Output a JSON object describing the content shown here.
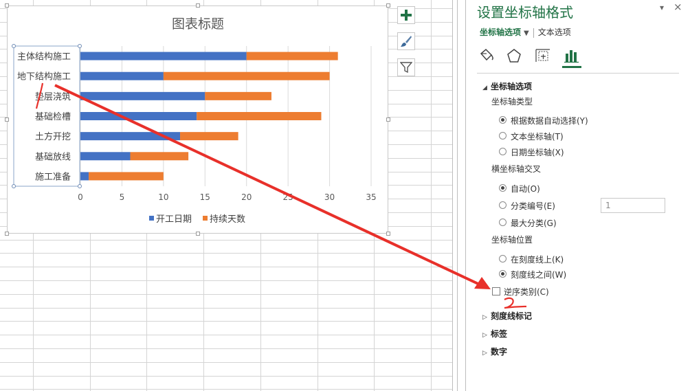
{
  "chart_data": {
    "type": "bar",
    "orientation": "horizontal",
    "stacked": true,
    "title": "图表标题",
    "categories": [
      "主体结构施工",
      "地下结构施工",
      "垫层浇筑",
      "基础检槽",
      "土方开挖",
      "基础放线",
      "施工准备"
    ],
    "series": [
      {
        "name": "开工日期",
        "color": "#4472c4",
        "values": [
          20,
          10,
          15,
          14,
          12,
          6,
          1
        ]
      },
      {
        "name": "持续天数",
        "color": "#ed7d31",
        "values": [
          11,
          20,
          8,
          15,
          7,
          7,
          9
        ]
      }
    ],
    "xlim": [
      0,
      35
    ],
    "xticks": [
      "0",
      "5",
      "10",
      "15",
      "20",
      "25",
      "30",
      "35"
    ],
    "grid": true,
    "legend_position": "bottom"
  },
  "pane": {
    "title": "设置坐标轴格式",
    "pin": "▾",
    "close": "×",
    "tab_axis_options": "坐标轴选项",
    "tab_text_options": "文本选项",
    "icons": [
      "fill-line-icon",
      "effects-icon",
      "size-properties-icon",
      "axis-options-icon"
    ],
    "section_axis_options": "坐标轴选项",
    "axis_type_label": "坐标轴类型",
    "axis_type_options": [
      {
        "label": "根据数据自动选择(Y)",
        "checked": true
      },
      {
        "label": "文本坐标轴(T)",
        "checked": false
      },
      {
        "label": "日期坐标轴(X)",
        "checked": false
      }
    ],
    "cross_label": "横坐标轴交叉",
    "cross_options": [
      {
        "label": "自动(O)",
        "checked": true
      },
      {
        "label": "分类编号(E)",
        "checked": false
      },
      {
        "label": "最大分类(G)",
        "checked": false
      }
    ],
    "category_number_value": "1",
    "position_label": "坐标轴位置",
    "position_options": [
      {
        "label": "在刻度线上(K)",
        "checked": false
      },
      {
        "label": "刻度线之间(W)",
        "checked": true
      }
    ],
    "reverse_label": "逆序类别(C)",
    "reverse_checked": false,
    "section_tick_marks": "刻度线标记",
    "section_labels": "标签",
    "section_number": "数字"
  },
  "chart_tools": [
    "chart-elements-button",
    "chart-styles-button",
    "chart-filters-button"
  ],
  "annotation": {
    "mark_1": "1",
    "mark_2": "2",
    "color": "#e8302a"
  }
}
